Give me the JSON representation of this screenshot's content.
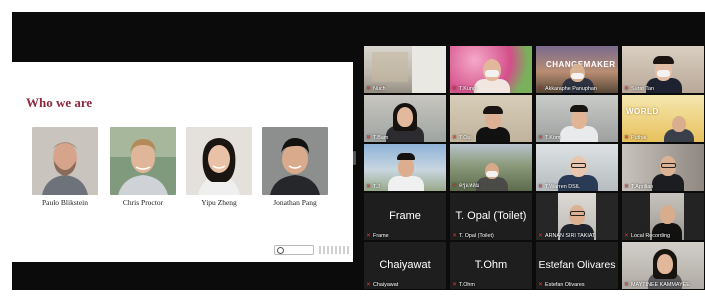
{
  "slide": {
    "title": "Who we are",
    "people": [
      {
        "name": "Paulo Blikstein"
      },
      {
        "name": "Chris Proctor"
      },
      {
        "name": "Yipu Zheng"
      },
      {
        "name": "Jonathan Pang"
      }
    ]
  },
  "gallery": {
    "tiles": [
      {
        "name": "Nuch"
      },
      {
        "name": "T.Kung"
      },
      {
        "name": "Akkaraphe Panuphan",
        "overlay": "CHANGEMAKER"
      },
      {
        "name": "Surat Tan"
      },
      {
        "name": "T.Bam"
      },
      {
        "name": "T.Oui"
      },
      {
        "name": "T.Kom"
      },
      {
        "name": "Puthai",
        "overlay": "WORLD"
      },
      {
        "name": "T.J"
      },
      {
        "name": "ครูแหลม"
      },
      {
        "name": "T.Warren DSIL"
      },
      {
        "name": "T.Aprilian"
      },
      {
        "name": "Frame",
        "display": "Frame"
      },
      {
        "name": "T. Opal (Toilet)",
        "display": "T. Opal (Toilet)"
      },
      {
        "name": "ARNAN SIRI TAKIAT"
      },
      {
        "name": "Local Recording"
      },
      {
        "name": "Chaiyawat",
        "display": "Chaiyawat"
      },
      {
        "name": "T.Ohm",
        "display": "T.Ohm"
      },
      {
        "name": "Estefan Olivares",
        "display": "Estefan Olivares"
      },
      {
        "name": "MAYTINEE KAMMAYEE"
      }
    ]
  },
  "colors": {
    "title": "#8e2a3c",
    "mic_muted": "#e5393f",
    "window_bg": "#0b0b0b"
  }
}
